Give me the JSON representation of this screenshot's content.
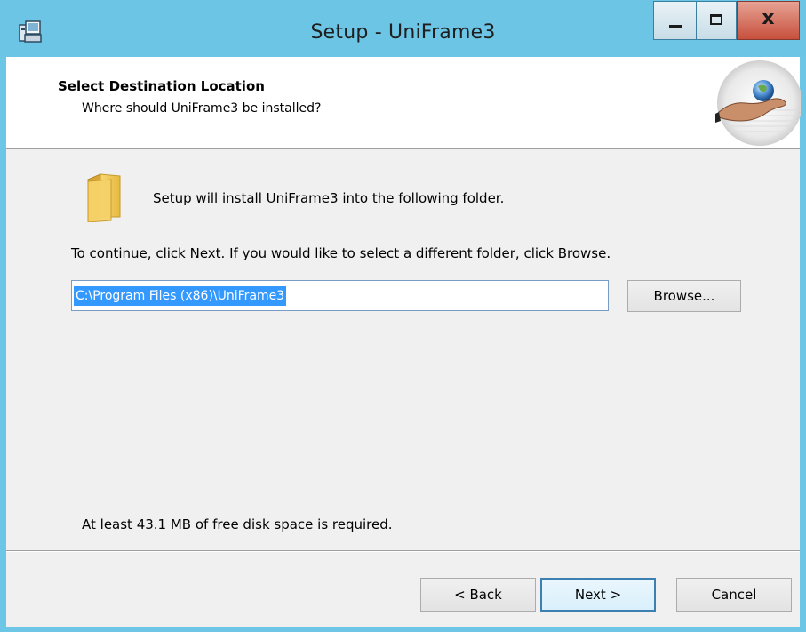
{
  "window": {
    "title": "Setup - UniFrame3",
    "close_glyph": "x"
  },
  "header": {
    "title": "Select Destination Location",
    "subtitle": "Where should UniFrame3 be installed?"
  },
  "body": {
    "intro": "Setup will install UniFrame3 into the following folder.",
    "instructions": "To continue, click Next. If you would like to select a different folder, click Browse.",
    "path_value": "C:\\Program Files (x86)\\UniFrame3",
    "browse_label": "Browse...",
    "disk_space": "At least 43.1 MB of free disk space is required."
  },
  "footer": {
    "back_label": "< Back",
    "next_label": "Next >",
    "cancel_label": "Cancel"
  },
  "icons": {
    "app": "setup-app-icon",
    "folder": "folder-icon",
    "logo": "globe-in-hand-icon"
  },
  "colors": {
    "titlebar": "#6cc5e5",
    "selection": "#3399ff",
    "close_button": "#c7503d",
    "default_button_border": "#3c7fb1"
  }
}
